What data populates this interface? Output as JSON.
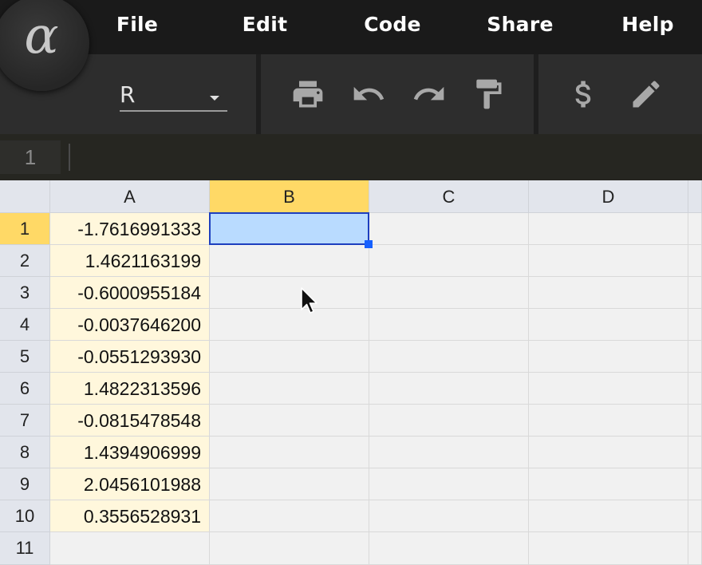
{
  "menu": {
    "items": [
      "File",
      "Edit",
      "Code",
      "Share",
      "Help"
    ]
  },
  "logo": {
    "symbol": "α"
  },
  "toolbar": {
    "language": "R",
    "icons": [
      "print-icon",
      "undo-icon",
      "redo-icon",
      "format-paint-icon",
      "currency-icon",
      "edit-icon"
    ]
  },
  "formula_bar": {
    "cell_ref": "1",
    "content": ""
  },
  "sheet": {
    "columns": [
      "A",
      "B",
      "C",
      "D"
    ],
    "active_column": "B",
    "active_row": 1,
    "rows": [
      {
        "n": "1",
        "a": "-1.7616991333"
      },
      {
        "n": "2",
        "a": "1.4621163199"
      },
      {
        "n": "3",
        "a": "-0.6000955184"
      },
      {
        "n": "4",
        "a": "-0.0037646200"
      },
      {
        "n": "5",
        "a": "-0.0551293930"
      },
      {
        "n": "6",
        "a": "1.4822313596"
      },
      {
        "n": "7",
        "a": "-0.0815478548"
      },
      {
        "n": "8",
        "a": "1.4394906999"
      },
      {
        "n": "9",
        "a": "2.0456101988"
      },
      {
        "n": "10",
        "a": "0.3556528931"
      },
      {
        "n": "11",
        "a": ""
      }
    ]
  },
  "colors": {
    "menubar": "#1a1a1a",
    "toolbar": "#2d2d2d",
    "active_header": "#ffd966",
    "selection_fill": "#b9dbff",
    "selection_border": "#1d3fbf",
    "column_a_fill": "#fff7dc"
  }
}
